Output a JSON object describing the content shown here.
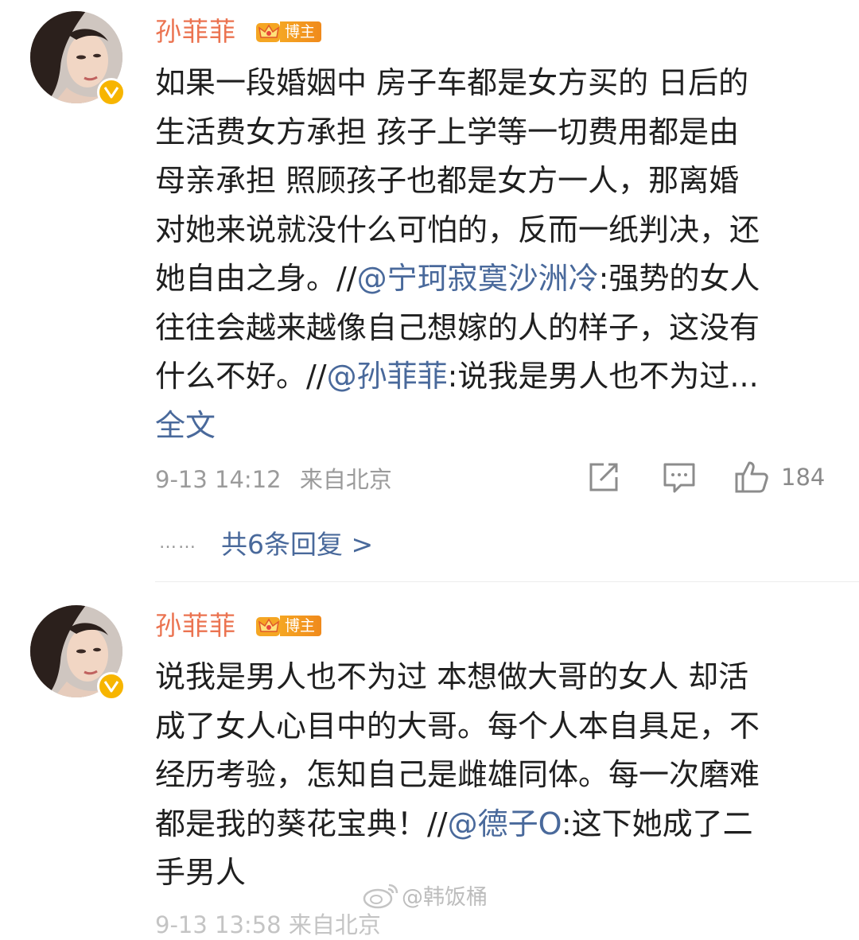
{
  "comments": [
    {
      "author": "孙菲菲",
      "badge": "博主",
      "text_lines": [
        "如果一段婚姻中 房子车都是女方买的 日后的",
        "生活费女方承担  孩子上学等一切费用都是由",
        "母亲承担  照顾孩子也都是女方一人，那离婚",
        "对她来说就没什么可怕的，反而一纸判决，还"
      ],
      "line5_pre": "她自由之身。//",
      "mention1": "@宁珂寂寞沙洲冷",
      "line5_post": ":强势的女人",
      "line6": "往往会越来越像自己想嫁的人的样子，这没有",
      "line7_pre": "什么不好。//",
      "mention2": "@孙菲菲",
      "line7_post": ":说我是男人也不为过...",
      "full_text": "全文",
      "time": "9-13 14:12",
      "source": "来自北京",
      "likes": "184",
      "replies_dots": "……",
      "replies": "共6条回复 >"
    },
    {
      "author": "孙菲菲",
      "badge": "博主",
      "text_lines": [
        "说我是男人也不为过 本想做大哥的女人 却活",
        "成了女人心目中的大哥。每个人本自具足，不",
        "经历考验，怎知自己是雌雄同体。每一次磨难"
      ],
      "line4_pre": "都是我的葵花宝典！//",
      "mention1": "@德子O",
      "line4_post": ":这下她成了二",
      "line5": "手男人",
      "cut_meta": "9-13 13:58  来自北京"
    }
  ],
  "watermark": "@韩饭桶",
  "colors": {
    "name": "#eb7350",
    "link": "#49699b",
    "badge": "#f5a623",
    "verified": "#f7b500"
  }
}
